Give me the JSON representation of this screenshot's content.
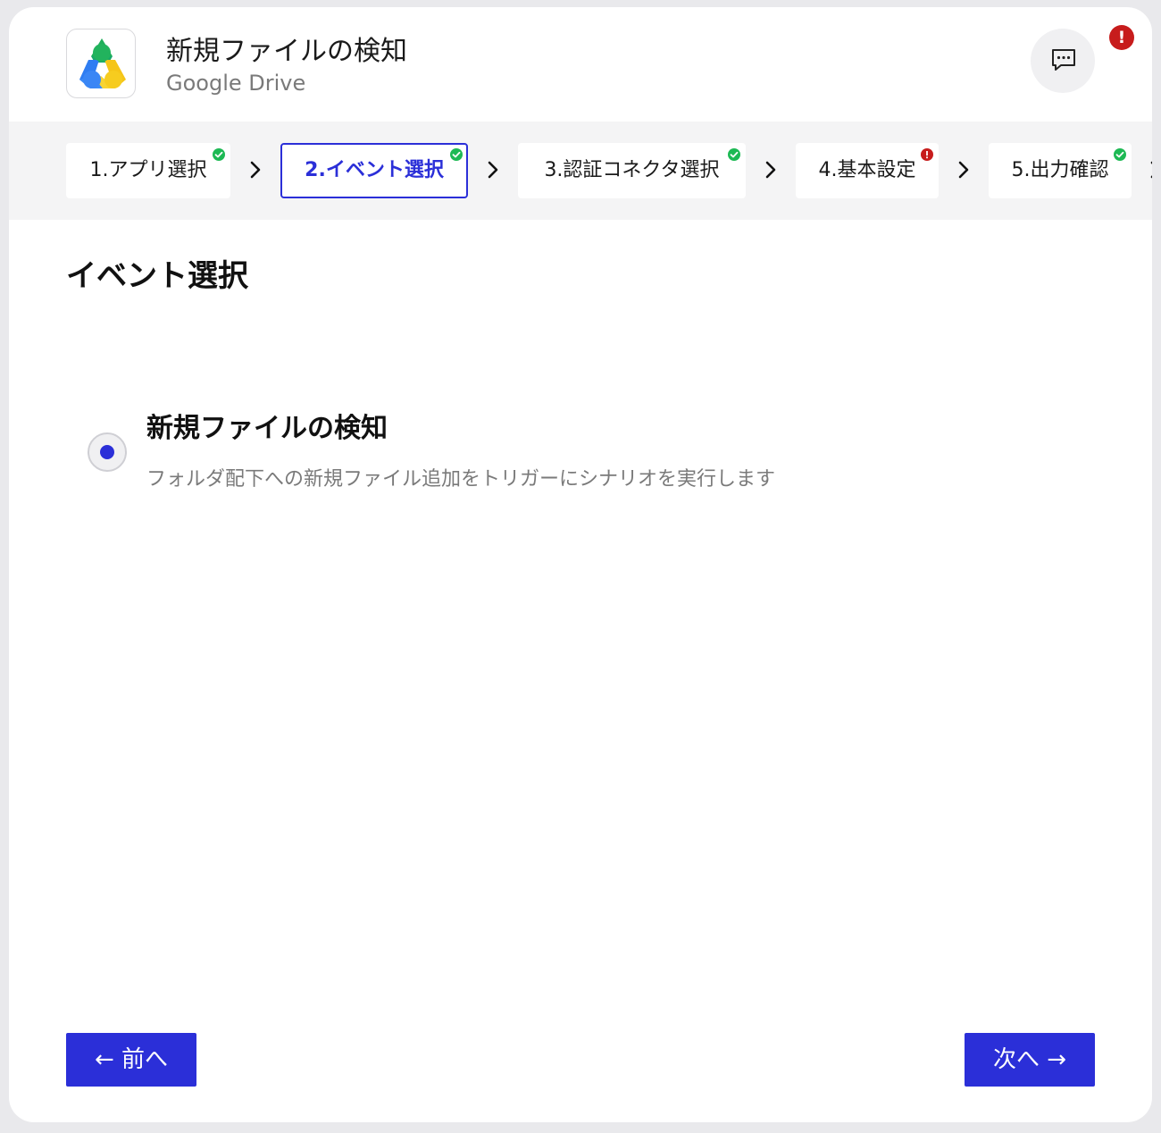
{
  "header": {
    "title": "新規ファイルの検知",
    "subtitle": "Google Drive",
    "app_icon": "google-drive-icon",
    "chat_icon": "chat-bubble-icon",
    "alert_badge": "!"
  },
  "steps": [
    {
      "label": "1.アプリ選択",
      "status": "complete"
    },
    {
      "label": "2.イベント選択",
      "status": "complete",
      "active": true
    },
    {
      "label": "3.認証コネクタ選択",
      "status": "complete"
    },
    {
      "label": "4.基本設定",
      "status": "error"
    },
    {
      "label": "5.出力確認",
      "status": "complete"
    }
  ],
  "content": {
    "section_title": "イベント選択",
    "option": {
      "title": "新規ファイルの検知",
      "description": "フォルダ配下への新規ファイル追加をトリガーにシナリオを実行します",
      "selected": true
    }
  },
  "footer": {
    "prev_label": "← 前へ",
    "next_label": "次へ →"
  },
  "colors": {
    "accent": "#2b2fd8",
    "success": "#1db954",
    "error": "#c71c1c"
  }
}
